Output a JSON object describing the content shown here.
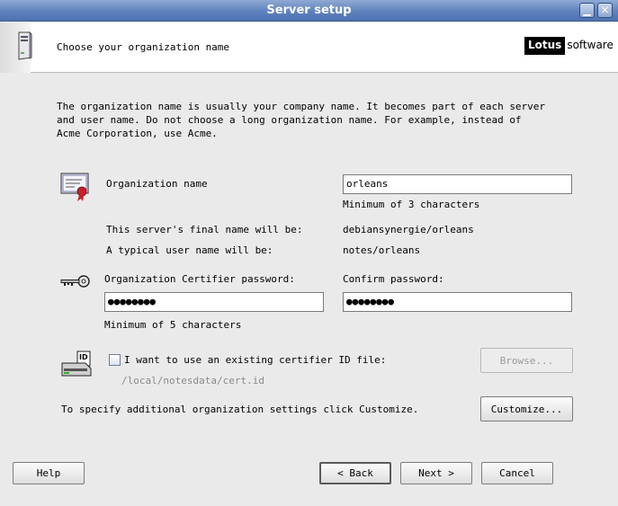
{
  "window": {
    "title": "Server setup"
  },
  "header": {
    "title": "Choose your organization name",
    "logo_lotus": "Lotus",
    "logo_software": "software"
  },
  "intro": "The organization name is usually your company name. It becomes part of each server\nand user name. Do not choose a long organization name. For example, instead of\nAcme Corporation, use Acme.",
  "org": {
    "label": "Organization name",
    "value": "orleans",
    "hint": "Minimum of 3 characters",
    "server_label": "This server's final name will be:",
    "server_value": "debiansynergie/orleans",
    "user_label": "A typical user name will be:",
    "user_value": "notes/orleans"
  },
  "password": {
    "label": "Organization Certifier password:",
    "value": "●●●●●●●●",
    "hint": "Minimum of 5 characters",
    "confirm_label": "Confirm password:",
    "confirm_value": "●●●●●●●●"
  },
  "certifier": {
    "checkbox_label": "I want to use an existing certifier ID file:",
    "checked": false,
    "path": "/local/notesdata/cert.id",
    "browse_button": "Browse..."
  },
  "customize": {
    "text": "To specify additional organization settings click Customize.",
    "button": "Customize..."
  },
  "footer": {
    "help": "Help",
    "back": "< Back",
    "next": "Next >",
    "cancel": "Cancel"
  }
}
